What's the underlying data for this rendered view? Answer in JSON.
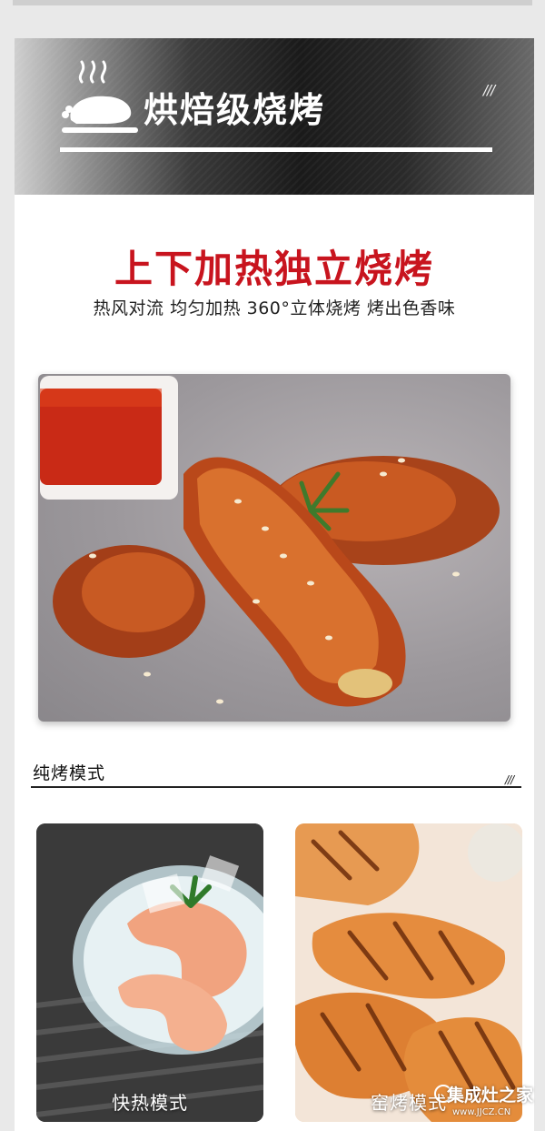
{
  "banner": {
    "title": "烘焙级烧烤",
    "slashes": "///"
  },
  "headline": "上下加热独立烧烤",
  "subline": "热风对流 均匀加热 360°立体烧烤 烤出色香味",
  "section": {
    "title": "纯烤模式",
    "slashes": "///"
  },
  "tiles": [
    {
      "label": "快热模式"
    },
    {
      "label": "窑烤模式"
    }
  ],
  "watermark": {
    "main": "集成灶之家",
    "sub": "www.JJCZ.CN"
  }
}
